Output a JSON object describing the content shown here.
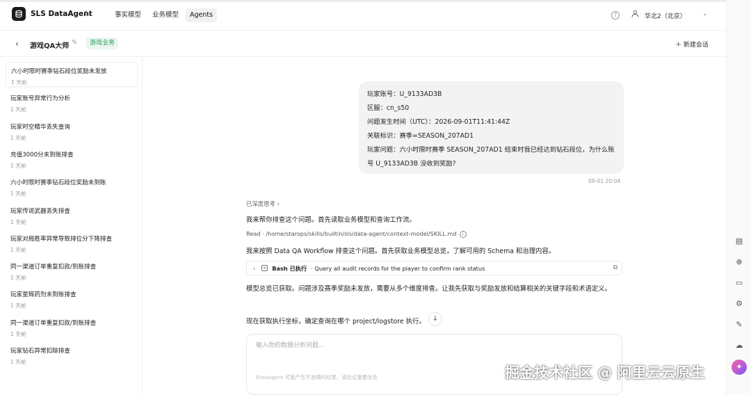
{
  "app": {
    "title": "SLS DataAgent"
  },
  "nav": {
    "tabs": [
      "事实模型",
      "业务模型",
      "Agents"
    ],
    "active": "Agents"
  },
  "header": {
    "region": "华北2（北京）"
  },
  "agent": {
    "name": "游戏QA大师",
    "tag": "游戏业务",
    "new_chat": "新建会话"
  },
  "sessions": [
    {
      "title": "六小时限时赛季钻石段位奖励未发放",
      "time": "1 天前"
    },
    {
      "title": "玩家账号异常行为分析",
      "time": "1 天前"
    },
    {
      "title": "玩家时空精华丢失查询",
      "time": "1 天前"
    },
    {
      "title": "充值3000分未到账排查",
      "time": "1 天前"
    },
    {
      "title": "六小时限时赛季钻石段位奖励未到账",
      "time": "1 天前"
    },
    {
      "title": "玩家传说武器丢失排查",
      "time": "1 天前"
    },
    {
      "title": "玩家对局胜率异常导致排位分下降排查",
      "time": "1 天前"
    },
    {
      "title": "同一渠道订单重复扣款/到账排查",
      "time": "1 天前"
    },
    {
      "title": "玩家星辉药剂未到账排查",
      "time": "1 天前"
    },
    {
      "title": "同一渠道订单重复扣款/到账排查",
      "time": "1 天前"
    },
    {
      "title": "玩家钻石异常扣除排查",
      "time": "1 天前"
    }
  ],
  "user_message": {
    "lines": [
      "玩家账号：U_9133AD3B",
      "区服：cn_s50",
      "问题发生时间（UTC）：2026-09-01T11:41:44Z",
      "关联标识：赛季=SEASON_207AD1",
      "玩家问题：六小时限时赛季 SEASON_207AD1 结束时我已经达到钻石段位，为什么账号 U_9133AD3B 没收到奖励?"
    ],
    "time": "09-01 20:04"
  },
  "assistant": {
    "thinking_label": "已深度思考",
    "p1": "我来帮你排查这个问题。首先读取业务模型和查询工作流。",
    "read_line": "Read · /home/starops/skills/builtin/sls/data-agent/context-model/SKILL.md",
    "p2": "我来按照 Data QA Workflow 排查这个问题。首先获取业务模型总览，了解可用的 Schema 和治理内容。",
    "bash_label": "Bash 已执行",
    "bash_desc": "· Query all audit records for the player to confirm rank status",
    "p3": "模型总览已获取。问题涉及赛季奖励未发放，需要从多个维度排查。让我先获取与奖励发放和结算相关的关键字段和术语定义。",
    "p4": "现在获取执行坐标，确定查询在哪个 project/logstore 执行。"
  },
  "input": {
    "placeholder": "输入你的数据分析问题...",
    "disclaimer": "DataAgent 可能产生不准确的结果，请验证重要信息"
  },
  "watermark": "掘金技术社区 @ 阿里云云原生",
  "icons": {
    "logo": "database-icon",
    "refresh": "refresh-icon",
    "help": "help-circle-icon",
    "user": "user-icon",
    "back": "chevron-left-icon",
    "edit": "pencil-icon",
    "plus": "plus-icon",
    "terminal": "terminal-icon",
    "copy": "copy-icon"
  }
}
